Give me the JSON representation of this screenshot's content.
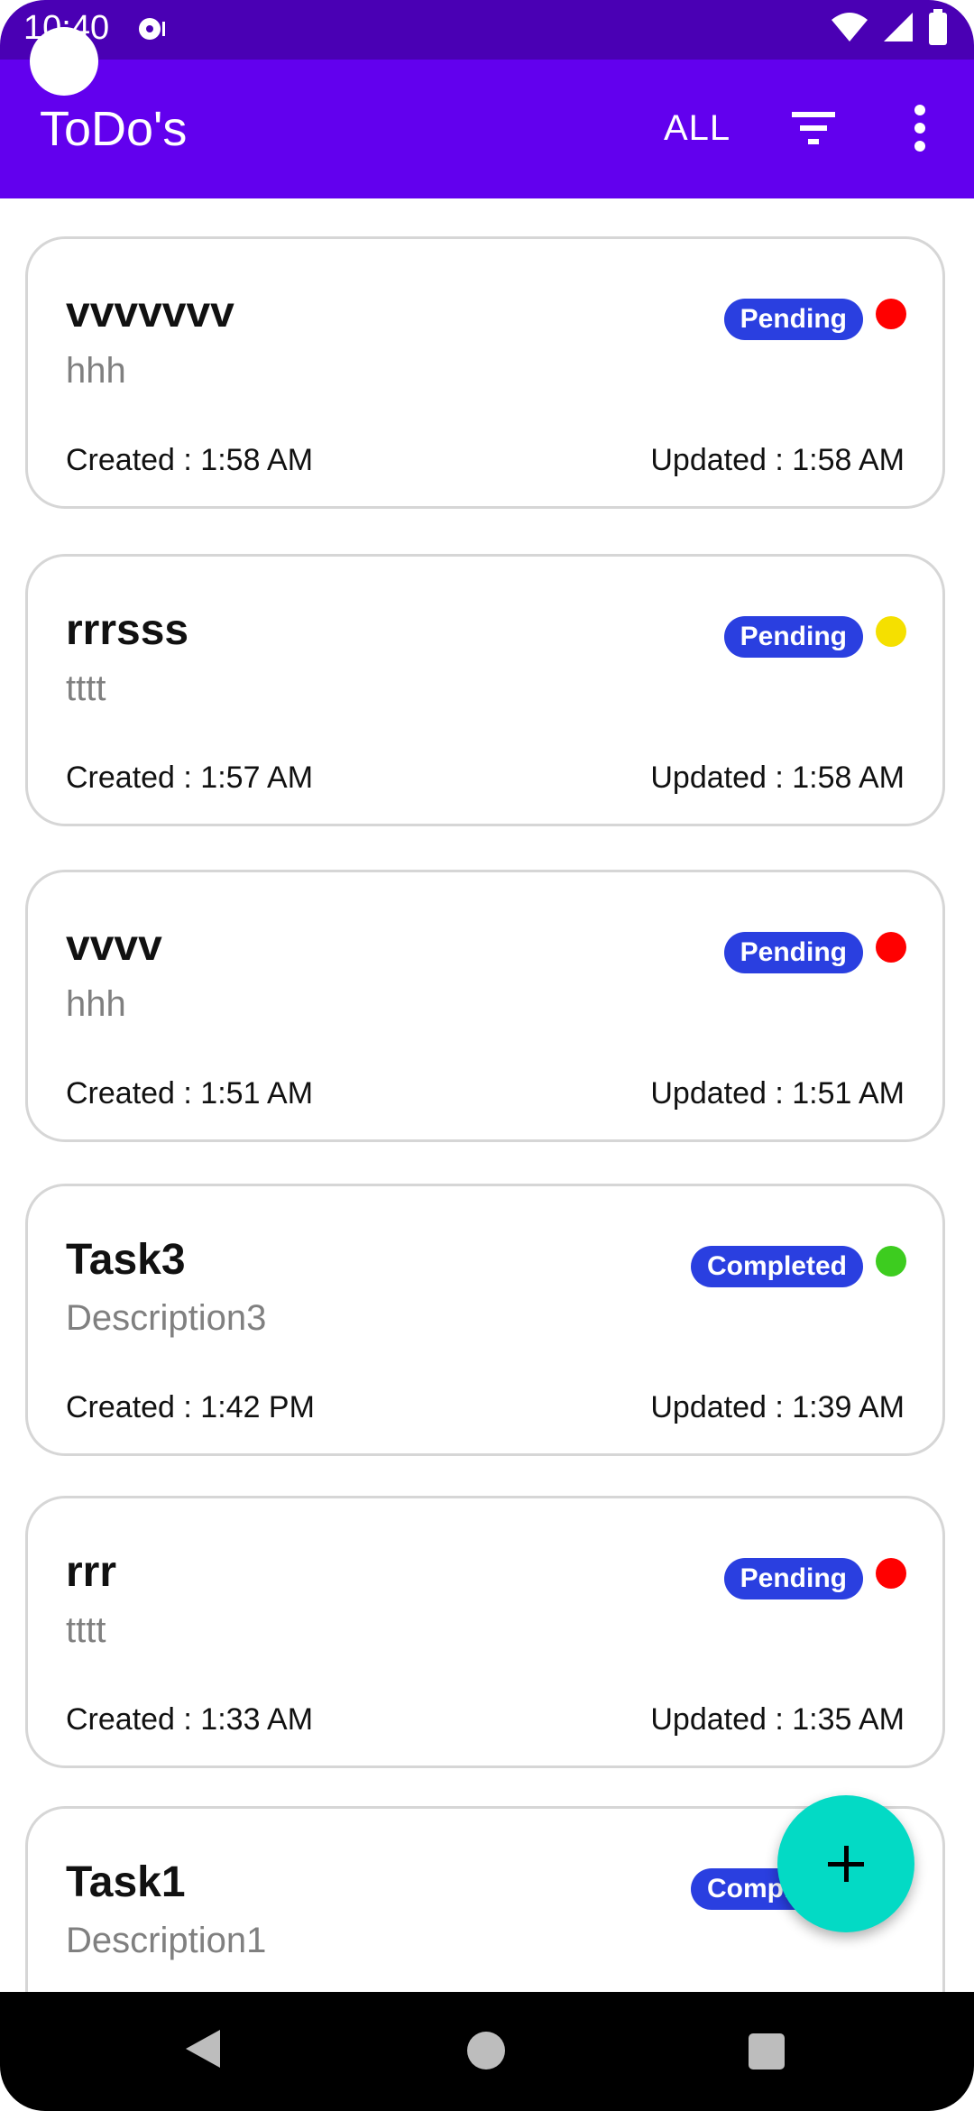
{
  "status_bar": {
    "time": "10:40"
  },
  "app_bar": {
    "title": "ToDo's",
    "filter_label": "ALL"
  },
  "colors": {
    "app_bar": "#6200ee",
    "status_bar": "#4a00b4",
    "chip": "#2a3fe0",
    "fab": "#03dac5",
    "red": "#ff0000",
    "yellow": "#f5e000",
    "green": "#3dcc1f"
  },
  "todos": [
    {
      "title": "vvvvvvv",
      "description": "hhh",
      "status": "Pending",
      "priority_color": "red",
      "created": "Created : 1:58 AM",
      "updated": "Updated : 1:58 AM"
    },
    {
      "title": "rrrsss",
      "description": "tttt",
      "status": "Pending",
      "priority_color": "yellow",
      "created": "Created : 1:57 AM",
      "updated": "Updated : 1:58 AM"
    },
    {
      "title": "vvvv",
      "description": "hhh",
      "status": "Pending",
      "priority_color": "red",
      "created": "Created : 1:51 AM",
      "updated": "Updated : 1:51 AM"
    },
    {
      "title": "Task3",
      "description": "Description3",
      "status": "Completed",
      "priority_color": "green",
      "created": "Created : 1:42 PM",
      "updated": "Updated : 1:39 AM"
    },
    {
      "title": "rrr",
      "description": "tttt",
      "status": "Pending",
      "priority_color": "red",
      "created": "Created : 1:33 AM",
      "updated": "Updated : 1:35 AM"
    },
    {
      "title": "Task1",
      "description": "Description1",
      "status": "Completed",
      "priority_color": "green",
      "created": "",
      "updated": ""
    }
  ],
  "icons": {
    "filter": "filter-icon",
    "more": "more-vert-icon",
    "add": "plus-icon",
    "back": "back-icon",
    "home": "home-icon",
    "recents": "recents-icon"
  }
}
